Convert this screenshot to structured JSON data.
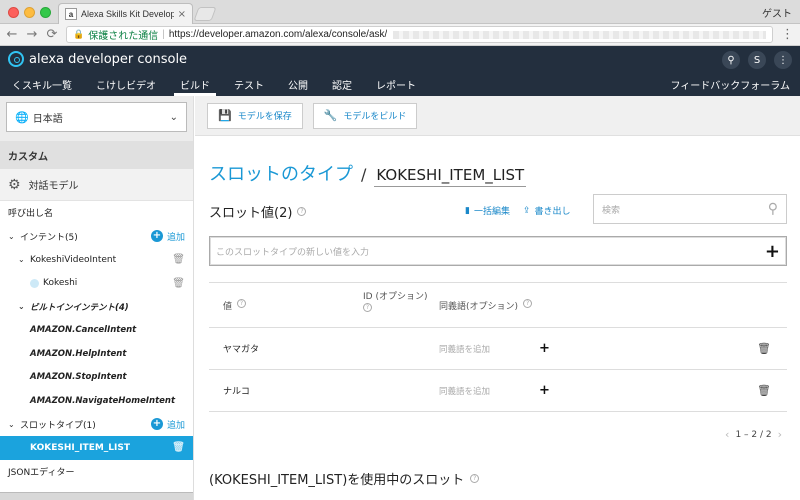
{
  "browser": {
    "tab_title": "Alexa Skills Kit Developer Conso",
    "tab_close": "×",
    "guest": "ゲスト",
    "secure_label": "保護された通信",
    "url": "https://developer.amazon.com/alexa/console/ask/"
  },
  "header": {
    "brand": "alexa developer console",
    "user_initial": "S",
    "nav": [
      {
        "label": "くスキル一覧"
      },
      {
        "label": "こけしビデオ"
      },
      {
        "label": "ビルド"
      },
      {
        "label": "テスト"
      },
      {
        "label": "公開"
      },
      {
        "label": "認定"
      },
      {
        "label": "レポート"
      }
    ],
    "feedback": "フィードバックフォーラム"
  },
  "sidebar": {
    "language": "日本語",
    "section": "カスタム",
    "model": "対話モデル",
    "invocation": "呼び出し名",
    "intents_label": "インテント(5)",
    "add_label": "追加",
    "intent_kokeshi": "KokeshiVideoIntent",
    "slot_kokeshi": "Kokeshi",
    "builtin_label": "ビルトインインテント(4)",
    "builtin": [
      "AMAZON.CancelIntent",
      "AMAZON.HelpIntent",
      "AMAZON.StopIntent",
      "AMAZON.NavigateHomeIntent"
    ],
    "slot_types_label": "スロットタイプ(1)",
    "slot_type_item": "KOKESHI_ITEM_LIST",
    "json_editor": "JSONエディター"
  },
  "toolbar": {
    "save": "モデルを保存",
    "build": "モデルをビルド"
  },
  "main": {
    "breadcrumb_link": "スロットのタイプ",
    "breadcrumb_sep": "/",
    "slot_type_name": "KOKESHI_ITEM_LIST",
    "slot_values_title": "スロット値(2)",
    "bulk_edit": "一括編集",
    "export": "書き出し",
    "search_placeholder": "検索",
    "new_value_placeholder": "このスロットタイプの新しい値を入力",
    "columns": {
      "value": "値",
      "id": "ID (オプション)",
      "synonyms": "同義語(オプション)"
    },
    "rows": [
      {
        "value": "ヤマガタ",
        "synonym_placeholder": "同義語を追加"
      },
      {
        "value": "ナルコ",
        "synonym_placeholder": "同義語を追加"
      }
    ],
    "pager": "1 – 2 / 2",
    "usage_title": "(KOKESHI_ITEM_LIST)を使用中のスロット"
  }
}
